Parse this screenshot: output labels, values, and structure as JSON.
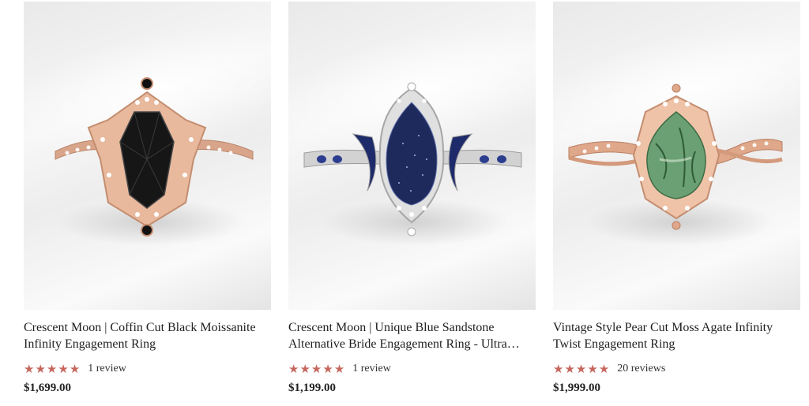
{
  "products": [
    {
      "title": "Crescent Moon | Coffin Cut Black Moissanite Infinity Engagement Ring",
      "stars": [
        "★",
        "★",
        "★",
        "★",
        "★"
      ],
      "rating_value": 5,
      "review_text": "1 review",
      "price": "$1,699.00",
      "image_icon": "black-coffin-ring-image",
      "colors": {
        "band": "#d9a58a",
        "stone": "#1a1a1a"
      }
    },
    {
      "title": "Crescent Moon | Unique Blue Sandstone Alternative Bride Engagement Ring - Ultra…",
      "stars": [
        "★",
        "★",
        "★",
        "★",
        "★"
      ],
      "rating_value": 5,
      "review_text": "1 review",
      "price": "$1,199.00",
      "image_icon": "blue-sandstone-ring-image",
      "colors": {
        "band": "#c8c8c8",
        "stone": "#1f2a5c"
      }
    },
    {
      "title": "Vintage Style Pear Cut Moss Agate Infinity Twist Engagement Ring",
      "stars": [
        "★",
        "★",
        "★",
        "★",
        "★"
      ],
      "rating_value": 5,
      "review_text": "20 reviews",
      "price": "$1,999.00",
      "image_icon": "moss-agate-ring-image",
      "colors": {
        "band": "#e0a88a",
        "stone": "#4f8a55"
      }
    }
  ],
  "accent_star_color": "#c6675e"
}
